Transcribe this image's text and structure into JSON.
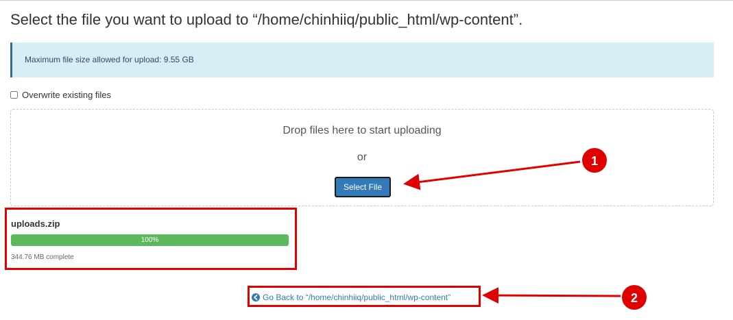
{
  "page": {
    "title": "Select the file you want to upload to “/home/chinhiiq/public_html/wp-content”."
  },
  "alert": {
    "text": "Maximum file size allowed for upload: 9.55 GB"
  },
  "overwrite": {
    "label": "Overwrite existing files",
    "checked": false
  },
  "dropzone": {
    "prompt": "Drop files here to start uploading",
    "or": "or",
    "select_label": "Select File"
  },
  "upload": {
    "file_name": "uploads.zip",
    "progress_label": "100%",
    "progress_value": 100,
    "status": "344.76 MB complete"
  },
  "back_link": {
    "label": "Go Back to “/home/chinhiiq/public_html/wp-content”"
  },
  "annotations": {
    "badge_1": "1",
    "badge_2": "2"
  },
  "colors": {
    "primary": "#337ab7",
    "success": "#5cb85c",
    "alert_bg": "#d9edf7",
    "annotation_red": "#e00000"
  }
}
